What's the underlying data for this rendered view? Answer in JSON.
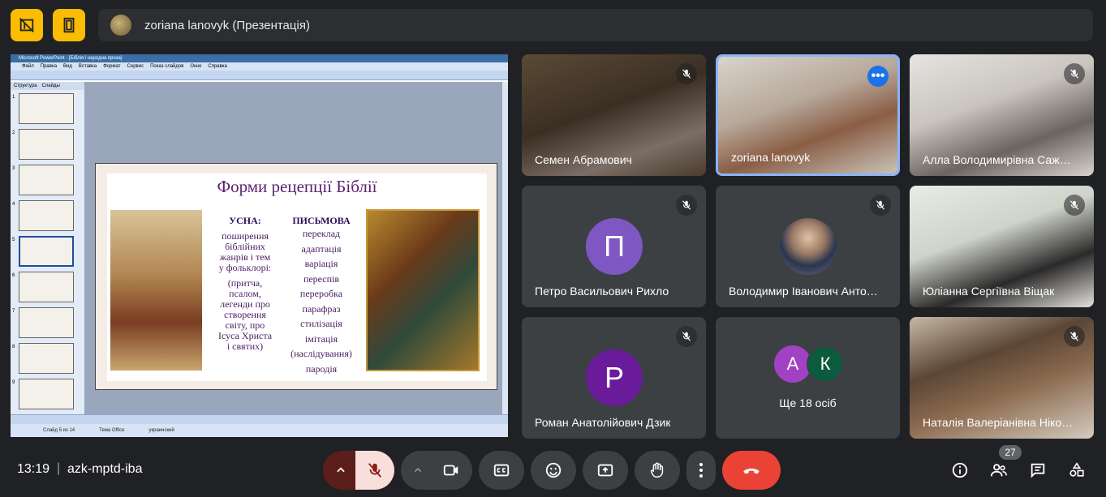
{
  "header": {
    "presenter_label": "zoriana lanovyk (Презентація)"
  },
  "slide": {
    "ppt_window_title": "Microsoft PowerPoint - [Біблія і народна проза]",
    "ppt_menu": [
      "Файл",
      "Правка",
      "Вид",
      "Вставка",
      "Формат",
      "Сервис",
      "Показ слайдов",
      "Окно",
      "Справка"
    ],
    "thumb_tabs": [
      "Структура",
      "Слайды"
    ],
    "thumb_numbers": [
      "1",
      "2",
      "3",
      "4",
      "5",
      "6",
      "7",
      "8",
      "9"
    ],
    "title": "Форми рецепції Біблії",
    "col1_head": "УСНА:",
    "col1_lines": [
      "поширення",
      "біблійних",
      "жанрів і тем",
      "у фольклорі:",
      "",
      "(притча,",
      "псалом,",
      "легенди про",
      "створення",
      "світу, про",
      "Ісуса Христа",
      "і святих)"
    ],
    "col2_head": "ПИСЬМОВА",
    "col2_lines": [
      "переклад",
      "адаптація",
      "варіація",
      "переспів",
      "переробка",
      "парафраз",
      "стилізація",
      "імітація",
      "(наслідування)",
      "пародія"
    ],
    "status": [
      "Слайд 5 из 14",
      "Тема Office",
      "украинский"
    ]
  },
  "participants": [
    {
      "name": "Семен Абрамович",
      "muted": true
    },
    {
      "name": "zoriana lanovyk",
      "muted": false,
      "active": true
    },
    {
      "name": "Алла Володимирівна Саж…",
      "muted": true
    },
    {
      "name": "Петро Васильович Рихло",
      "muted": true,
      "initial": "П",
      "color": "#7e57c2"
    },
    {
      "name": "Володимир Іванович Анто…",
      "muted": true
    },
    {
      "name": "Юліанна Сергіївна Віщак",
      "muted": true
    },
    {
      "name": "Роман Анатолійович Дзик",
      "muted": true,
      "initial": "P",
      "color": "#6a1b9a"
    },
    {
      "name": "Наталія Валеріанівна Ніко…",
      "muted": true
    }
  ],
  "others": {
    "initials": [
      "А",
      "К"
    ],
    "label": "Ще 18 осіб"
  },
  "footer": {
    "time": "13:19",
    "separator": "|",
    "meeting_code": "azk-mptd-iba",
    "people_count": "27"
  }
}
